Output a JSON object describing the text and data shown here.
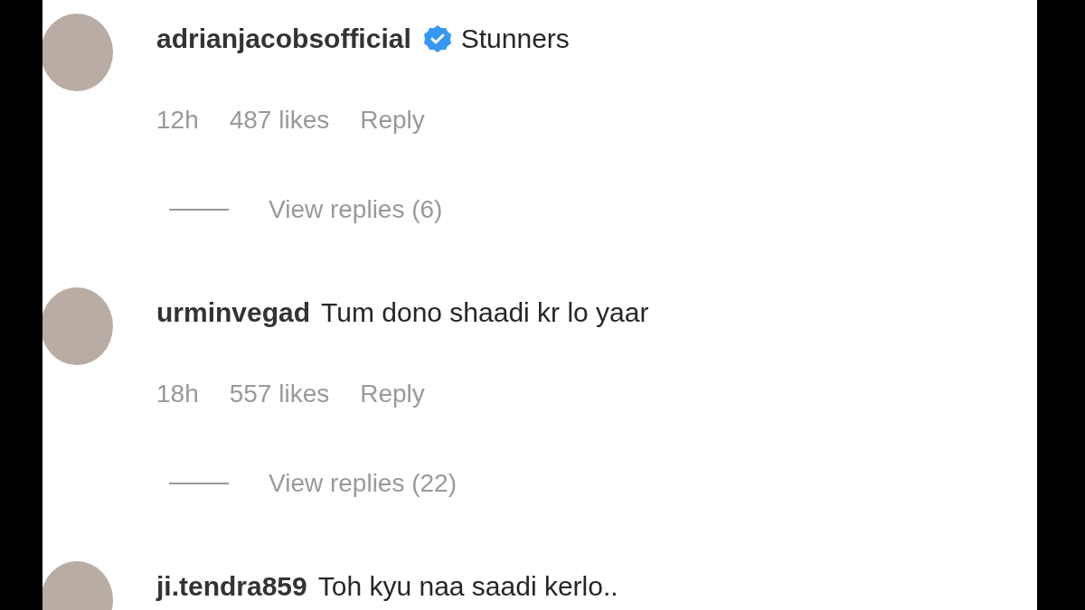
{
  "comments": [
    {
      "username": "adrianjacobsofficial",
      "verified": true,
      "text": "Stunners",
      "time": "12h",
      "likes": "487 likes",
      "reply": "Reply",
      "view_replies": "View replies (6)"
    },
    {
      "username": "urminvegad",
      "verified": false,
      "text": "Tum dono shaadi kr lo yaar",
      "time": "18h",
      "likes": "557 likes",
      "reply": "Reply",
      "view_replies": "View replies (22)"
    },
    {
      "username": "ji.tendra859",
      "verified": false,
      "text": "Toh kyu naa saadi kerlo.."
    }
  ]
}
